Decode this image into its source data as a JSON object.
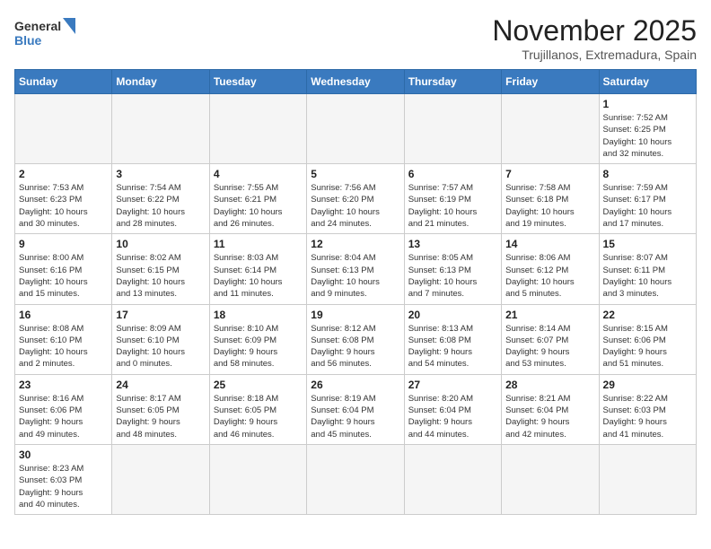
{
  "logo": {
    "line1": "General",
    "line2": "Blue"
  },
  "title": "November 2025",
  "location": "Trujillanos, Extremadura, Spain",
  "weekdays": [
    "Sunday",
    "Monday",
    "Tuesday",
    "Wednesday",
    "Thursday",
    "Friday",
    "Saturday"
  ],
  "days": [
    {
      "date": "",
      "info": ""
    },
    {
      "date": "",
      "info": ""
    },
    {
      "date": "",
      "info": ""
    },
    {
      "date": "",
      "info": ""
    },
    {
      "date": "",
      "info": ""
    },
    {
      "date": "",
      "info": ""
    },
    {
      "date": "1",
      "info": "Sunrise: 7:52 AM\nSunset: 6:25 PM\nDaylight: 10 hours\nand 32 minutes."
    },
    {
      "date": "2",
      "info": "Sunrise: 7:53 AM\nSunset: 6:23 PM\nDaylight: 10 hours\nand 30 minutes."
    },
    {
      "date": "3",
      "info": "Sunrise: 7:54 AM\nSunset: 6:22 PM\nDaylight: 10 hours\nand 28 minutes."
    },
    {
      "date": "4",
      "info": "Sunrise: 7:55 AM\nSunset: 6:21 PM\nDaylight: 10 hours\nand 26 minutes."
    },
    {
      "date": "5",
      "info": "Sunrise: 7:56 AM\nSunset: 6:20 PM\nDaylight: 10 hours\nand 24 minutes."
    },
    {
      "date": "6",
      "info": "Sunrise: 7:57 AM\nSunset: 6:19 PM\nDaylight: 10 hours\nand 21 minutes."
    },
    {
      "date": "7",
      "info": "Sunrise: 7:58 AM\nSunset: 6:18 PM\nDaylight: 10 hours\nand 19 minutes."
    },
    {
      "date": "8",
      "info": "Sunrise: 7:59 AM\nSunset: 6:17 PM\nDaylight: 10 hours\nand 17 minutes."
    },
    {
      "date": "9",
      "info": "Sunrise: 8:00 AM\nSunset: 6:16 PM\nDaylight: 10 hours\nand 15 minutes."
    },
    {
      "date": "10",
      "info": "Sunrise: 8:02 AM\nSunset: 6:15 PM\nDaylight: 10 hours\nand 13 minutes."
    },
    {
      "date": "11",
      "info": "Sunrise: 8:03 AM\nSunset: 6:14 PM\nDaylight: 10 hours\nand 11 minutes."
    },
    {
      "date": "12",
      "info": "Sunrise: 8:04 AM\nSunset: 6:13 PM\nDaylight: 10 hours\nand 9 minutes."
    },
    {
      "date": "13",
      "info": "Sunrise: 8:05 AM\nSunset: 6:13 PM\nDaylight: 10 hours\nand 7 minutes."
    },
    {
      "date": "14",
      "info": "Sunrise: 8:06 AM\nSunset: 6:12 PM\nDaylight: 10 hours\nand 5 minutes."
    },
    {
      "date": "15",
      "info": "Sunrise: 8:07 AM\nSunset: 6:11 PM\nDaylight: 10 hours\nand 3 minutes."
    },
    {
      "date": "16",
      "info": "Sunrise: 8:08 AM\nSunset: 6:10 PM\nDaylight: 10 hours\nand 2 minutes."
    },
    {
      "date": "17",
      "info": "Sunrise: 8:09 AM\nSunset: 6:10 PM\nDaylight: 10 hours\nand 0 minutes."
    },
    {
      "date": "18",
      "info": "Sunrise: 8:10 AM\nSunset: 6:09 PM\nDaylight: 9 hours\nand 58 minutes."
    },
    {
      "date": "19",
      "info": "Sunrise: 8:12 AM\nSunset: 6:08 PM\nDaylight: 9 hours\nand 56 minutes."
    },
    {
      "date": "20",
      "info": "Sunrise: 8:13 AM\nSunset: 6:08 PM\nDaylight: 9 hours\nand 54 minutes."
    },
    {
      "date": "21",
      "info": "Sunrise: 8:14 AM\nSunset: 6:07 PM\nDaylight: 9 hours\nand 53 minutes."
    },
    {
      "date": "22",
      "info": "Sunrise: 8:15 AM\nSunset: 6:06 PM\nDaylight: 9 hours\nand 51 minutes."
    },
    {
      "date": "23",
      "info": "Sunrise: 8:16 AM\nSunset: 6:06 PM\nDaylight: 9 hours\nand 49 minutes."
    },
    {
      "date": "24",
      "info": "Sunrise: 8:17 AM\nSunset: 6:05 PM\nDaylight: 9 hours\nand 48 minutes."
    },
    {
      "date": "25",
      "info": "Sunrise: 8:18 AM\nSunset: 6:05 PM\nDaylight: 9 hours\nand 46 minutes."
    },
    {
      "date": "26",
      "info": "Sunrise: 8:19 AM\nSunset: 6:04 PM\nDaylight: 9 hours\nand 45 minutes."
    },
    {
      "date": "27",
      "info": "Sunrise: 8:20 AM\nSunset: 6:04 PM\nDaylight: 9 hours\nand 44 minutes."
    },
    {
      "date": "28",
      "info": "Sunrise: 8:21 AM\nSunset: 6:04 PM\nDaylight: 9 hours\nand 42 minutes."
    },
    {
      "date": "29",
      "info": "Sunrise: 8:22 AM\nSunset: 6:03 PM\nDaylight: 9 hours\nand 41 minutes."
    },
    {
      "date": "30",
      "info": "Sunrise: 8:23 AM\nSunset: 6:03 PM\nDaylight: 9 hours\nand 40 minutes."
    }
  ]
}
